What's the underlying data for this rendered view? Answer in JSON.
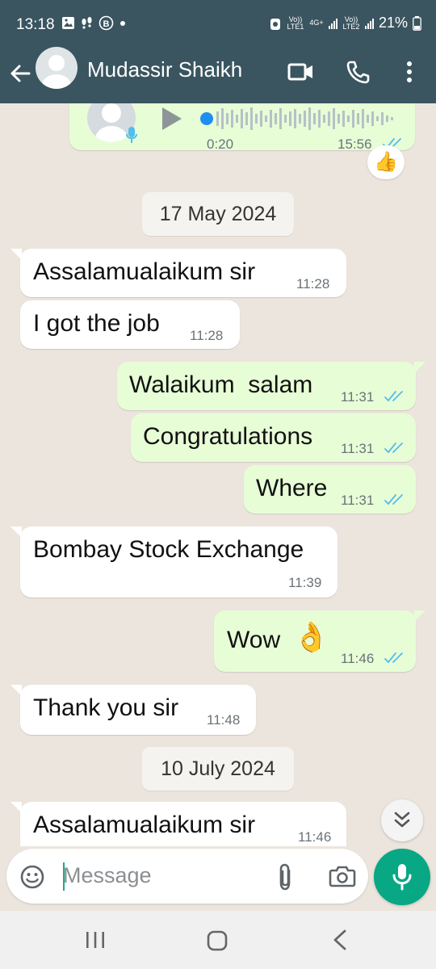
{
  "status": {
    "time": "13:18",
    "battery": "21%",
    "volte1": "Vo)) LTE1",
    "volte2": "Vo)) LTE2",
    "net": "4G+"
  },
  "header": {
    "contact_name": "Mudassir Shaikh"
  },
  "voice_note": {
    "duration": "0:20",
    "time": "15:56",
    "reaction": "👍"
  },
  "dates": [
    "17 May 2024",
    "10 July 2024"
  ],
  "messages": [
    {
      "text": "Assalamualaikum sir",
      "time": "11:28"
    },
    {
      "text": "I got the job",
      "time": "11:28"
    },
    {
      "text": "Walaikum  salam",
      "time": "11:31"
    },
    {
      "text": "Congratulations",
      "time": "11:31"
    },
    {
      "text": "Where",
      "time": "11:31"
    },
    {
      "text": "Bombay Stock Exchange",
      "time": "11:39"
    },
    {
      "text": "Wow",
      "emoji": "👌",
      "time": "11:46"
    },
    {
      "text": "Thank you sir",
      "time": "11:48"
    },
    {
      "text": "Assalamualaikum sir",
      "time": "11:46"
    }
  ],
  "composer": {
    "placeholder": "Message"
  },
  "colors": {
    "header": "#3a5560",
    "outgoing": "#e7fdd6",
    "incoming": "#ffffff",
    "wallpaper": "#ece5dd",
    "accent": "#08a884",
    "tick_blue": "#53bdeb"
  },
  "icons": [
    "back-arrow-icon",
    "video-call-icon",
    "phone-icon",
    "more-icon",
    "emoji-icon",
    "attach-icon",
    "camera-icon",
    "mic-icon",
    "scroll-down-icon",
    "play-icon"
  ]
}
